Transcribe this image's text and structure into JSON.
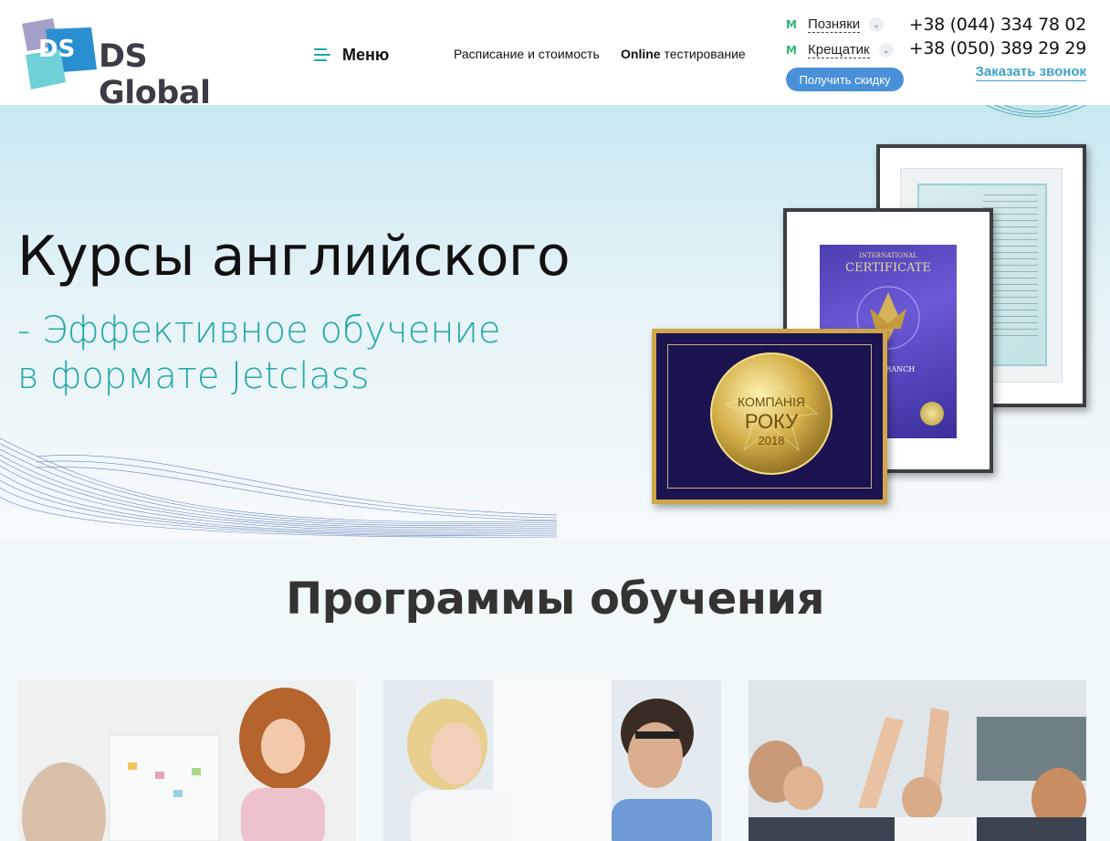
{
  "header": {
    "logo_text": "DS Global",
    "logo_monogram": "DS",
    "menu_label": "Меню",
    "nav": [
      {
        "label": "Расписание и стоимость"
      },
      {
        "bold": "Online",
        "label": " тестирование"
      }
    ],
    "locations": [
      {
        "metro": "M",
        "name": "Позняки"
      },
      {
        "metro": "M",
        "name": "Крещатик"
      }
    ],
    "discount_button": "Получить скидку",
    "phones": [
      "+38 (044) 334 78 02",
      "+38 (050) 389 29 29"
    ],
    "callback_link": "Заказать звонок"
  },
  "hero": {
    "title": "Курсы английского",
    "subtitle_line1": "- Эффективное обучение",
    "subtitle_line2": "в формате Jetclass",
    "certificate_heading": "INTERNATIONAL",
    "certificate_title": "CERTIFICATE",
    "certificate_footer": "THE BRANCH",
    "award_line1": "КОМПАНІЯ",
    "award_line2": "РОКУ",
    "award_year": "2018"
  },
  "programs": {
    "title": "Программы обучения"
  },
  "colors": {
    "accent_teal": "#25a8a8",
    "button_blue": "#4a90d9",
    "link_blue": "#3aa0c8",
    "metro_green": "#2bb673"
  }
}
